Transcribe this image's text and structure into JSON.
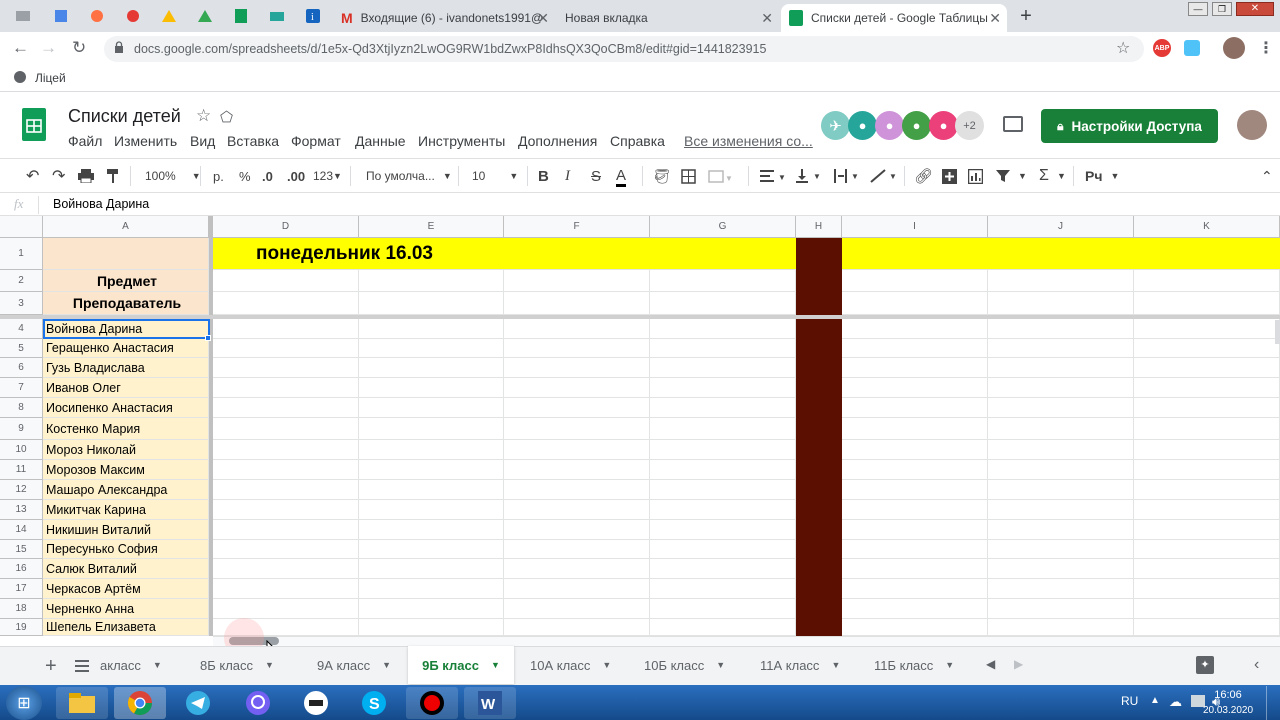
{
  "browser": {
    "tabs": [
      {
        "label": "Входящие (6) - ivandonets1991@"
      },
      {
        "label": "Новая вкладка"
      },
      {
        "label": "Списки детей - Google Таблицы"
      }
    ],
    "url": "docs.google.com/spreadsheets/d/1e5x-Qd3XtjIyzn2LwOG9RW1bdZwxP8IdhsQX3QoCBm8/edit#gid=1441823915",
    "bookmark": "Ліцей",
    "abp": "ABP"
  },
  "doc": {
    "title": "Списки детей",
    "menus": [
      "Файл",
      "Изменить",
      "Вид",
      "Вставка",
      "Формат",
      "Данные",
      "Инструменты",
      "Дополнения",
      "Справка"
    ],
    "last_edit": "Все изменения со...",
    "share_label": "Настройки Доступа",
    "extra_viewers": "+2"
  },
  "toolbar": {
    "zoom": "100%",
    "currency": "р.",
    "percent": "%",
    "dec_less": ".0",
    "dec_more": ".00",
    "format_more": "123",
    "font": "По умолча...",
    "font_size": "10",
    "bold": "B",
    "italic": "I",
    "strike": "S",
    "textcolor": "A",
    "input_tool": "Рч"
  },
  "formula": {
    "fx": "fx",
    "value": "Войнова Дарина"
  },
  "grid": {
    "columns": [
      "A",
      "D",
      "E",
      "F",
      "G",
      "H",
      "I",
      "J",
      "K"
    ],
    "row_numbers": [
      "1",
      "2",
      "3",
      "4",
      "5",
      "6",
      "7",
      "8",
      "9",
      "10",
      "11",
      "12",
      "13",
      "14",
      "15",
      "16",
      "17",
      "18",
      "19"
    ],
    "date_header": "понедельник 16.03",
    "subject_label": "Предмет",
    "teacher_label": "Преподаватель",
    "students": [
      "Войнова Дарина",
      "Геращенко Анастасия",
      "Гузь Владислава",
      "Иванов Олег",
      "Иосипенко Анастасия",
      "Костенко Мария",
      "Мороз Николай",
      "Морозов Максим",
      "Машаро Александра",
      "Микитчак Карина",
      "Никишин Виталий",
      "Пересунько София",
      "Салюк Виталий",
      "Черкасов Артём",
      "Черненко Анна",
      "Шепель Елизавета"
    ],
    "colors": {
      "header_yellow": "#ffff00",
      "name_fill": "#fff2cc",
      "subject_fill": "#fce5cd",
      "separator": "#5b0f00"
    }
  },
  "sheets": {
    "tabs": [
      "акласс",
      "8Б класс",
      "9А класс",
      "9Б класс",
      "10А класс",
      "10Б класс",
      "11А класс",
      "11Б класс"
    ],
    "active": "9Б класс"
  },
  "taskbar": {
    "lang": "RU",
    "time": "16:06",
    "date": "20.03.2020"
  }
}
